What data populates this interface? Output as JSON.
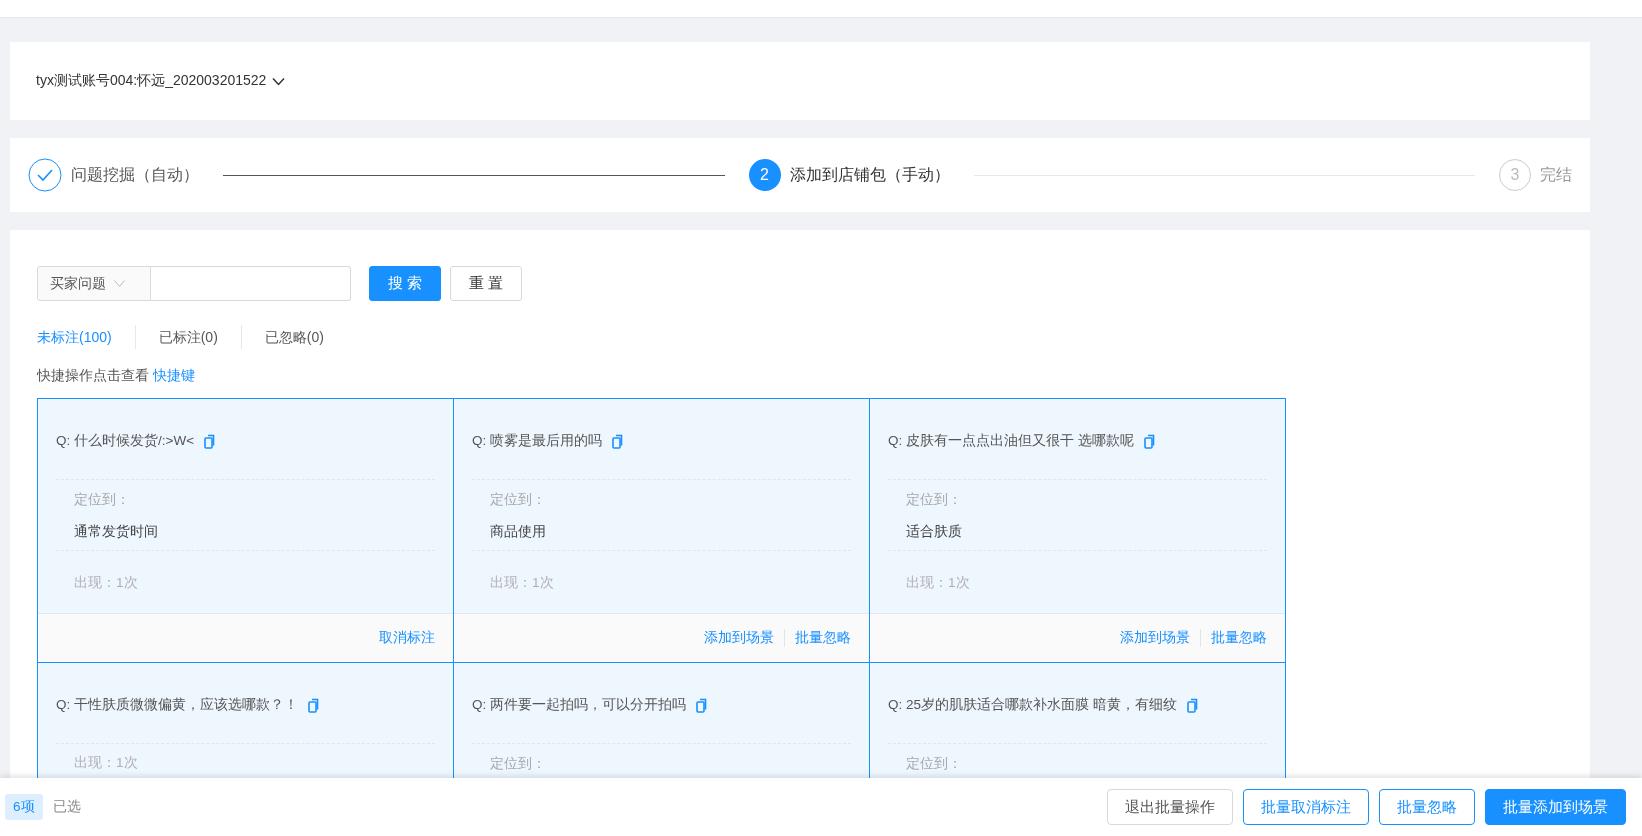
{
  "account": {
    "label": "tyx测试账号004:怀远_202003201522"
  },
  "steps": [
    {
      "label": "问题挖掘（自动）",
      "done": true,
      "active": false
    },
    {
      "number": "2",
      "label": "添加到店铺包（手动）",
      "done": false,
      "active": true
    },
    {
      "number": "3",
      "label": "完结",
      "done": false,
      "active": false
    }
  ],
  "search": {
    "field_select": "买家问题",
    "buttons": [
      {
        "label": "搜 索",
        "kind": "primary"
      },
      {
        "label": "重 置",
        "kind": "default"
      }
    ]
  },
  "filter_tabs": [
    {
      "label": "未标注(100)",
      "selected": true
    },
    {
      "label": "已标注(0)",
      "selected": false
    },
    {
      "label": "已忽略(0)",
      "selected": false
    }
  ],
  "shortcut_hint": {
    "text": "快捷操作点击查看",
    "link": "快捷键"
  },
  "cards": [
    {
      "question": "Q: 什么时候发货/:>W<",
      "location_label": "定位到：",
      "location": "通常发货时间",
      "occurrence": "出现：1次",
      "actions": [
        "取消标注"
      ],
      "selected": true
    },
    {
      "question": "Q: 喷雾是最后用的吗",
      "location_label": "定位到：",
      "location": "商品使用",
      "occurrence": "出现：1次",
      "actions": [
        "添加到场景",
        "批量忽略"
      ],
      "selected": true
    },
    {
      "question": "Q: 皮肤有一点点出油但又很干 选哪款呢",
      "location_label": "定位到：",
      "location": "适合肤质",
      "occurrence": "出现：1次",
      "actions": [
        "添加到场景",
        "批量忽略"
      ],
      "selected": true
    },
    {
      "question": "Q: 干性肤质微微偏黄，应该选哪款？！",
      "occurrence": "出现：1次",
      "selected": true
    },
    {
      "question": "Q: 两件要一起拍吗，可以分开拍吗",
      "location_label": "定位到：",
      "selected": true
    },
    {
      "question": "Q: 25岁的肌肤适合哪款补水面膜 暗黄，有细纹",
      "location_label": "定位到：",
      "selected": true
    }
  ],
  "selection_bar": {
    "count": "6项",
    "label": "已选",
    "buttons": [
      {
        "label": "退出批量操作",
        "kind": "default"
      },
      {
        "label": "批量取消标注",
        "kind": "outline"
      },
      {
        "label": "批量忽略",
        "kind": "outline"
      },
      {
        "label": "批量添加到场景",
        "kind": "primary"
      }
    ]
  }
}
